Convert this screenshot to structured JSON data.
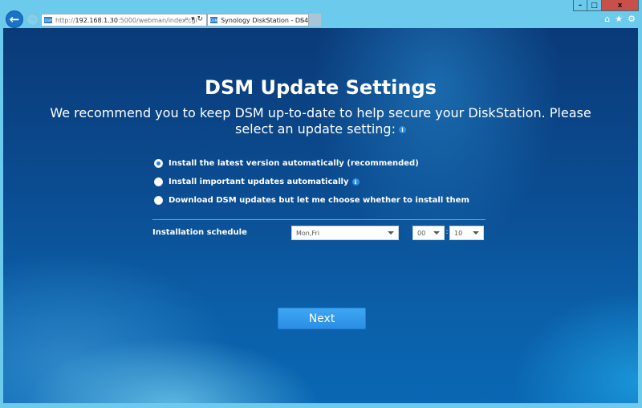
{
  "window": {
    "minimize_glyph": "–",
    "maximize_glyph": "□",
    "close_glyph": "x"
  },
  "browser": {
    "back_glyph": "←",
    "forward_glyph": "→",
    "address": {
      "prefix": "http://",
      "host": "192.168.1.30",
      "rest": ":5000/webman/index.cgi"
    },
    "address_icons": "⌕ ▾ ↻",
    "favicon_text": "DSM",
    "tab_title": "Synology DiskStation - DS4...",
    "tab_close": "×",
    "home_glyph": "⌂",
    "favorites_glyph": "★",
    "settings_glyph": "⚙"
  },
  "page": {
    "title": "DSM Update Settings",
    "description": "We recommend you to keep DSM up-to-date to help secure your DiskStation. Please select an update setting:",
    "info_glyph": "i",
    "options": [
      {
        "label": "Install the latest version automatically (recommended)",
        "checked": true,
        "info": false
      },
      {
        "label": "Install important updates automatically",
        "checked": false,
        "info": true
      },
      {
        "label": "Download DSM updates but let me choose whether to install them",
        "checked": false,
        "info": false
      }
    ],
    "schedule": {
      "label": "Installation schedule",
      "days": "Mon,Fri",
      "hour": "00",
      "separator": ":",
      "minute": "10"
    },
    "next_label": "Next"
  }
}
